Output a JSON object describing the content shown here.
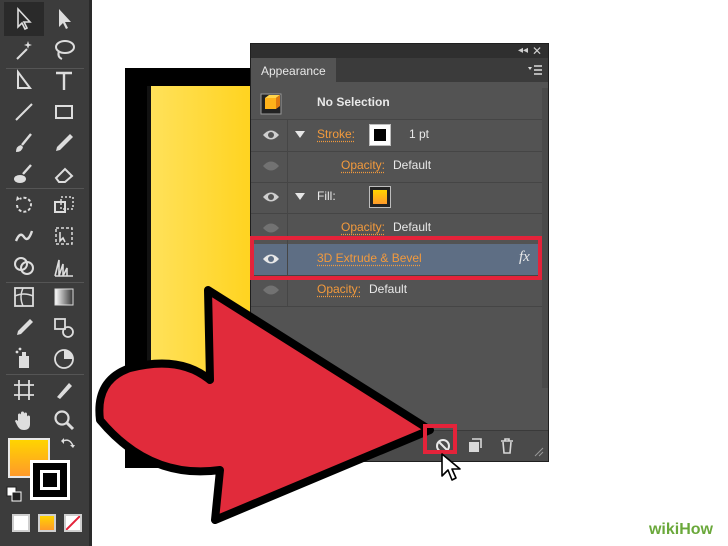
{
  "panel": {
    "tab_label": "Appearance",
    "collapse_glyph": "◂◂",
    "close_glyph": "✕",
    "selection_label": "No Selection",
    "rows": [
      {
        "label": "Stroke:",
        "value": "1 pt",
        "type": "stroke"
      },
      {
        "label": "Opacity:",
        "value": "Default",
        "type": "opacity"
      },
      {
        "label": "Fill:",
        "value": "",
        "type": "fill"
      },
      {
        "label": "Opacity:",
        "value": "Default",
        "type": "opacity"
      },
      {
        "label": "3D Extrude & Bevel",
        "value": "fx",
        "type": "effect"
      },
      {
        "label": "Opacity:",
        "value": "Default",
        "type": "opacity"
      }
    ]
  },
  "colors": {
    "highlight": "#e4233a",
    "accent_text": "#f39a3c",
    "arrow": "#e12b3b",
    "book": "#ffd21a"
  },
  "watermark": {
    "text": "wikiHow"
  },
  "icons": {
    "toolbox": [
      "selection-tool-icon",
      "direct-selection-tool-icon",
      "magic-wand-tool-icon",
      "lasso-tool-icon",
      "pen-tool-icon",
      "type-tool-icon",
      "line-tool-icon",
      "rectangle-tool-icon",
      "paintbrush-tool-icon",
      "pencil-tool-icon",
      "blob-brush-tool-icon",
      "eraser-tool-icon",
      "rotate-tool-icon",
      "scale-tool-icon",
      "warp-tool-icon",
      "free-transform-tool-icon",
      "shape-builder-tool-icon",
      "perspective-grid-tool-icon",
      "mesh-tool-icon",
      "gradient-tool-icon",
      "eyedropper-tool-icon",
      "blend-tool-icon",
      "symbol-sprayer-tool-icon",
      "graph-tool-icon",
      "artboard-tool-icon",
      "slice-tool-icon",
      "hand-tool-icon",
      "zoom-tool-icon"
    ]
  }
}
